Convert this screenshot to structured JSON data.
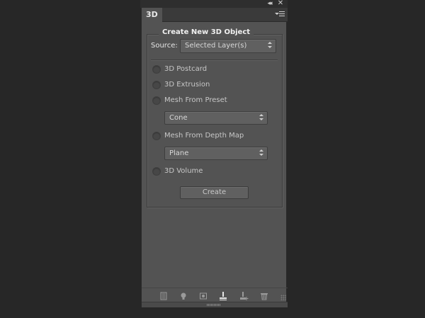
{
  "panel": {
    "tab_label": "3D",
    "collapse_glyph": "◂◂",
    "close_glyph": "✕"
  },
  "create_section": {
    "title": "Create New 3D Object",
    "source_label": "Source:",
    "source_value": "Selected Layer(s)"
  },
  "options": [
    {
      "label": "3D Postcard"
    },
    {
      "label": "3D Extrusion"
    },
    {
      "label": "Mesh From Preset"
    },
    {
      "label": "Mesh From Depth Map"
    },
    {
      "label": "3D Volume"
    }
  ],
  "preset_dropdown": {
    "value": "Cone"
  },
  "depthmap_dropdown": {
    "value": "Plane"
  },
  "create_button": {
    "label": "Create"
  },
  "bottom_icons": [
    "whole-scene-icon",
    "light-bulb-icon",
    "materials-icon",
    "mesh-icon",
    "add-light-icon",
    "trash-icon"
  ],
  "colors": {
    "background": "#272727",
    "panel": "#535353",
    "text": "#c7c7c7"
  }
}
